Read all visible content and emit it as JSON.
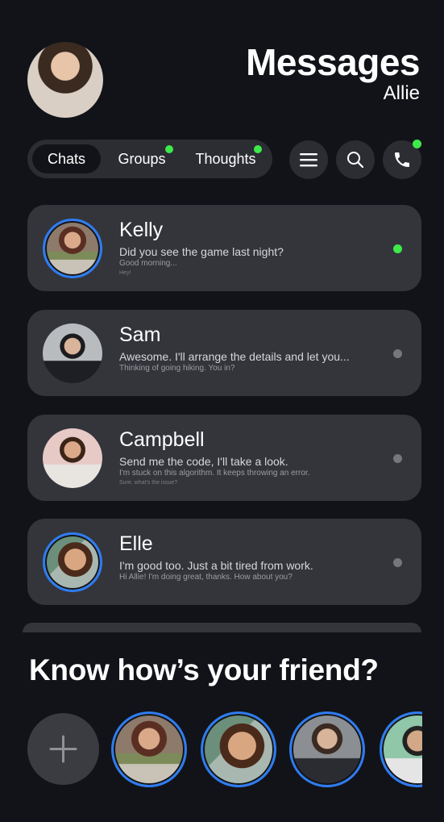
{
  "header": {
    "title": "Messages",
    "user_name": "Allie",
    "avatar_icon": "user-avatar"
  },
  "tabs": [
    {
      "label": "Chats",
      "active": true,
      "has_indicator": false
    },
    {
      "label": "Groups",
      "active": false,
      "has_indicator": true
    },
    {
      "label": "Thoughts",
      "active": false,
      "has_indicator": true
    }
  ],
  "toolbar": {
    "menu_icon": "menu-icon",
    "search_icon": "search-icon",
    "call_icon": "phone-icon",
    "call_has_indicator": true
  },
  "chats": [
    {
      "name": "Kelly",
      "message": "Did you see the game last night?",
      "preview_2": "Good morning...",
      "preview_3": "Hey!",
      "status": "online",
      "status_color": "#3ee94a",
      "avatar_ring": true
    },
    {
      "name": "Sam",
      "message": "Awesome. I'll arrange the details and let you...",
      "preview_2": "Thinking of going hiking. You in?",
      "preview_3": "",
      "status": "offline",
      "status_color": "#75777c",
      "avatar_ring": false
    },
    {
      "name": "Campbell",
      "message": "Send me the code, I'll take a look.",
      "preview_2": "I'm stuck on this algorithm. It keeps throwing an error.",
      "preview_3": "Sure, what's the issue?",
      "status": "offline",
      "status_color": "#75777c",
      "avatar_ring": false
    },
    {
      "name": "Elle",
      "message": "I'm good too. Just a bit tired from work.",
      "preview_2": "Hi Allie! I'm doing great, thanks. How about you?",
      "preview_3": "",
      "status": "offline",
      "status_color": "#75777c",
      "avatar_ring": true
    }
  ],
  "friends_section": {
    "title": "Know how’s your friend?",
    "add_icon": "plus-icon"
  },
  "colors": {
    "background": "#111318",
    "card": "#33353b",
    "accent_ring": "#2f7cf0",
    "online": "#3ee94a"
  }
}
